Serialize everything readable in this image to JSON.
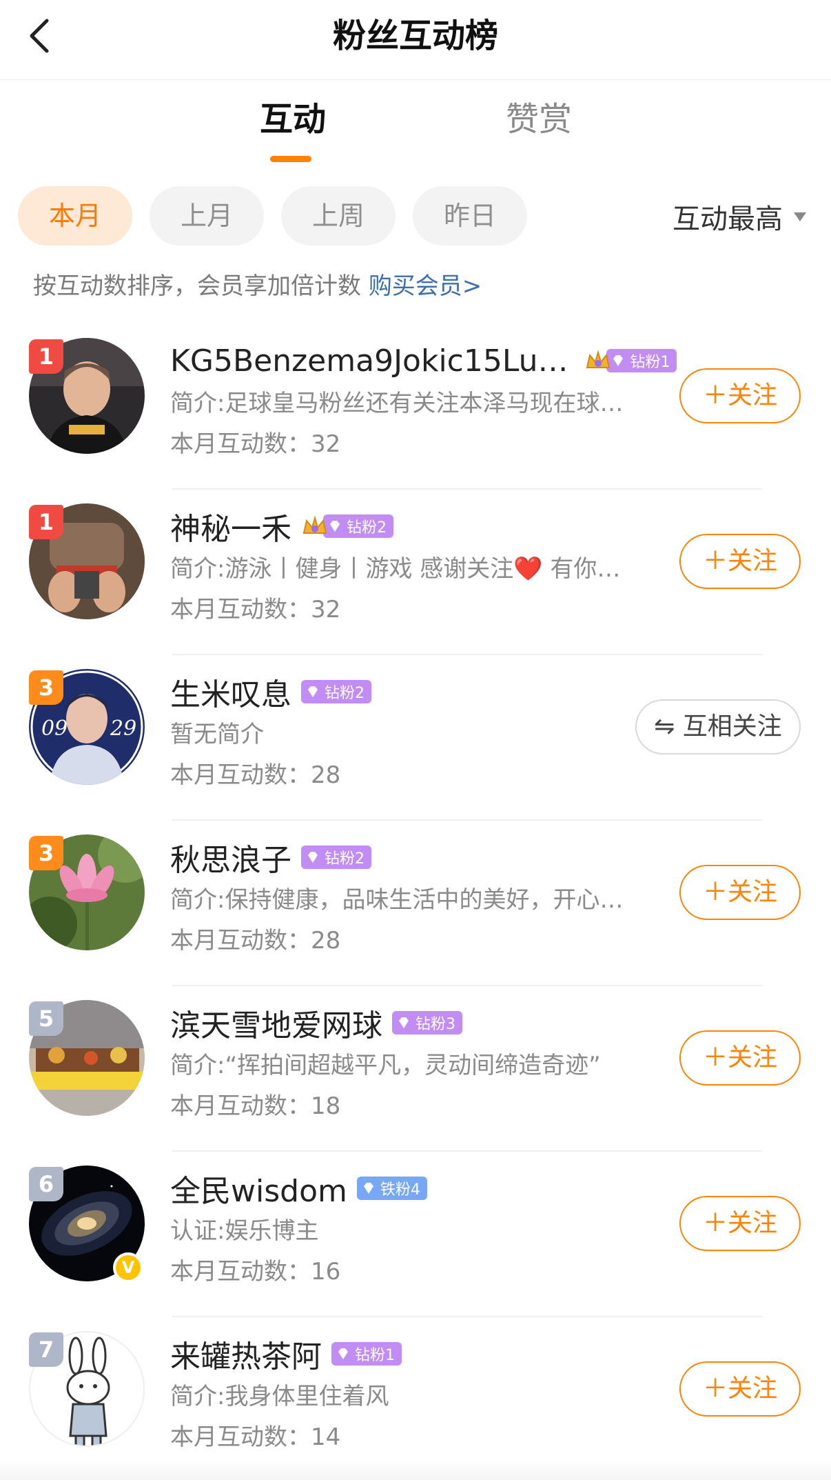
{
  "header": {
    "title": "粉丝互动榜"
  },
  "tabs": [
    {
      "label": "互动",
      "active": true
    },
    {
      "label": "赞赏",
      "active": false
    }
  ],
  "filters": {
    "chips": [
      {
        "label": "本月",
        "active": true
      },
      {
        "label": "上月",
        "active": false
      },
      {
        "label": "上周",
        "active": false
      },
      {
        "label": "昨日",
        "active": false
      }
    ],
    "sort_label": "互动最高"
  },
  "notice": {
    "text": "按互动数排序，会员享加倍计数",
    "link": "购买会员>"
  },
  "users": [
    {
      "rank": "1",
      "name": "KG5Benzema9Jokic15Lu…",
      "badge": "钻粉1",
      "crown": true,
      "bio": "简介:足球皇马粉丝还有关注本泽马现在球…",
      "count": "本月互动数：32",
      "button": "＋关注"
    },
    {
      "rank": "1",
      "name": "神秘一禾",
      "badge": "钻粉2",
      "crown": true,
      "bio": "简介:游泳丨健身丨游戏 感谢关注❤️ 有你…",
      "count": "本月互动数：32",
      "button": "＋关注"
    },
    {
      "rank": "3",
      "name": "生米叹息",
      "badge": "钻粉2",
      "crown": false,
      "bio": "暂无简介",
      "count": "本月互动数：28",
      "button": "⇋ 互相关注"
    },
    {
      "rank": "3",
      "name": "秋思浪子",
      "badge": "钻粉2",
      "crown": false,
      "bio": "简介:保持健康，品味生活中的美好，开心…",
      "count": "本月互动数：28",
      "button": "＋关注"
    },
    {
      "rank": "5",
      "name": "滨天雪地爱网球",
      "badge": "钻粉3",
      "crown": false,
      "bio": "简介:“挥拍间超越平凡，灵动间缔造奇迹”",
      "count": "本月互动数：18",
      "button": "＋关注"
    },
    {
      "rank": "6",
      "name": "全民wisdom",
      "badge": "铁粉4",
      "crown": false,
      "bio": "认证:娱乐博主",
      "count": "本月互动数：16",
      "button": "＋关注",
      "verified": "V"
    },
    {
      "rank": "7",
      "name": "来罐热茶阿",
      "badge": "钻粉1",
      "crown": false,
      "bio": "简介:我身体里住着风",
      "count": "本月互动数：14",
      "button": "＋关注"
    }
  ],
  "colors": {
    "accent": "#ff8200",
    "link": "#3d6fb0",
    "rank_red": "#f04a43",
    "rank_orange": "#ff8c1a",
    "rank_gray": "#aeb6c8",
    "badge_purple": "#c28cf5",
    "badge_blue": "#76a8f5"
  },
  "icons": {
    "back": "chevron-left-icon",
    "sort": "caret-down-icon",
    "badge": "diamond-icon",
    "crown": "crown-icon"
  }
}
